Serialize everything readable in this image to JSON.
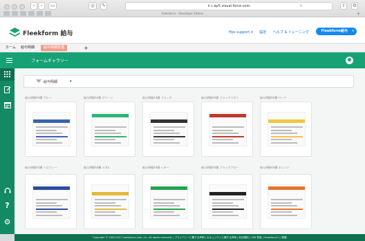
{
  "browser": {
    "url": "ii c.ap5.visual.force.com",
    "tab_title": "Salesforce - Developer Edition"
  },
  "header": {
    "brand": "Fleekform 給与",
    "links": [
      "ffps support",
      "設定",
      "ヘルプ & トレーニング"
    ],
    "user_button": "Fleekform給与"
  },
  "app_tabs": [
    "ホーム",
    "給与明細",
    "給与明細管理"
  ],
  "app_header": {
    "title": "フォームギャラリー"
  },
  "filter": {
    "label": "給与明細"
  },
  "rail": {
    "icons": [
      "gallery-icon",
      "edit-form-icon",
      "calendar-icon"
    ],
    "bottom_icons": [
      "headset-icon",
      "help-icon",
      "settings-icon"
    ],
    "help_glyph": "?"
  },
  "gallery": [
    {
      "title": "給与明細A4横 ブルー",
      "accent": "#3b63b3"
    },
    {
      "title": "給与明細A4横 グリーン",
      "accent": "#2bb673"
    },
    {
      "title": "給与明細A4横 ブラック",
      "accent": "#333333"
    },
    {
      "title": "給与明細A4横 ブラックリボン",
      "accent": "#c0392b"
    },
    {
      "title": "給与明細A4横 バード",
      "accent": "#f4c542"
    },
    {
      "title": "給与明細A4横 トロフィー",
      "accent": "#2a4d9c"
    },
    {
      "title": "給与明細A4横 メダル",
      "accent": "#e3b93b"
    },
    {
      "title": "給与明細A4横 レター",
      "accent": "#22a44a"
    },
    {
      "title": "給与明細A4横 ブラックアロー",
      "accent": "#222222"
    },
    {
      "title": "給与明細A4横 オレンジ",
      "accent": "#e8742c"
    }
  ],
  "footer": "Copyright © 2000-2017 salesforce.com, inc. All rights reserved. | プライバシーに関する声明 | セキュリティに関する声明 | 利用規約 | 508 準拠 | Salesforce1 に移動",
  "colors": {
    "primary": "#16a275",
    "rail": "#138a64",
    "link": "#0070d2",
    "button": "#1589ee"
  }
}
